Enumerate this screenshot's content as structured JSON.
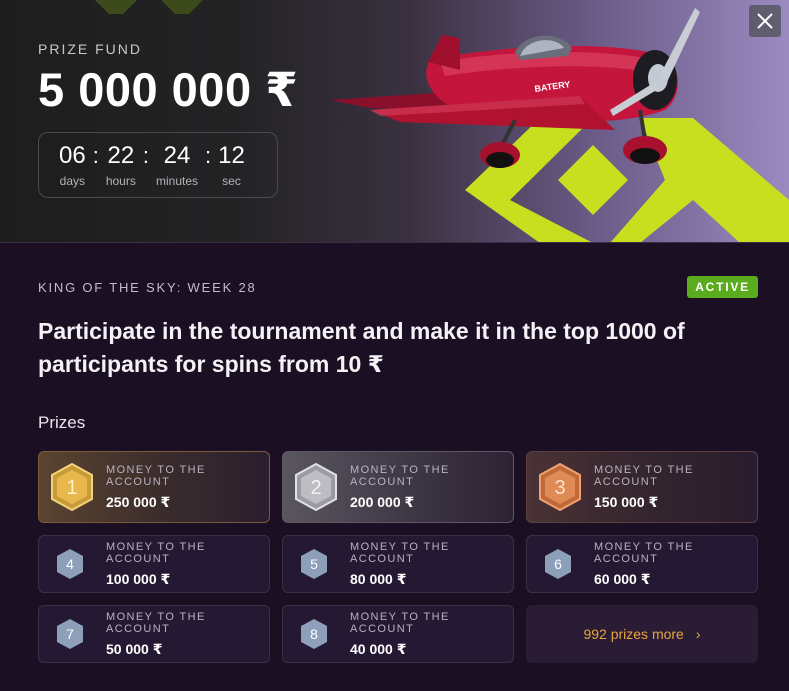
{
  "hero": {
    "prize_label": "PRIZE FUND",
    "prize_amount": "5 000 000 ₹",
    "plane_brand": "BATERY",
    "timer": {
      "days": {
        "value": "06",
        "label": "days"
      },
      "hours": {
        "value": "22",
        "label": "hours"
      },
      "minutes": {
        "value": "24",
        "label": "minutes"
      },
      "seconds": {
        "value": "12",
        "label": "sec"
      }
    }
  },
  "tournament": {
    "title": "KING OF THE SKY: WEEK 28",
    "status": "ACTIVE",
    "headline": "Participate in the tournament and make it in the top 1000 of participants for spins from 10 ₹"
  },
  "prizes": {
    "heading": "Prizes",
    "items": [
      {
        "place": "1",
        "label": "MONEY TO THE ACCOUNT",
        "amount": "250 000 ₹"
      },
      {
        "place": "2",
        "label": "MONEY TO THE ACCOUNT",
        "amount": "200 000 ₹"
      },
      {
        "place": "3",
        "label": "MONEY TO THE ACCOUNT",
        "amount": "150 000 ₹"
      },
      {
        "place": "4",
        "label": "MONEY TO THE ACCOUNT",
        "amount": "100 000 ₹"
      },
      {
        "place": "5",
        "label": "MONEY TO THE ACCOUNT",
        "amount": "80 000 ₹"
      },
      {
        "place": "6",
        "label": "MONEY TO THE ACCOUNT",
        "amount": "60 000 ₹"
      },
      {
        "place": "7",
        "label": "MONEY TO THE ACCOUNT",
        "amount": "50 000 ₹"
      },
      {
        "place": "8",
        "label": "MONEY TO THE ACCOUNT",
        "amount": "40 000 ₹"
      }
    ],
    "more_label": "992 prizes more"
  },
  "colors": {
    "accent_green": "#c6e01f",
    "active_badge": "#5bab1e",
    "link_orange": "#e8a53c",
    "plane_red": "#c4153c"
  }
}
